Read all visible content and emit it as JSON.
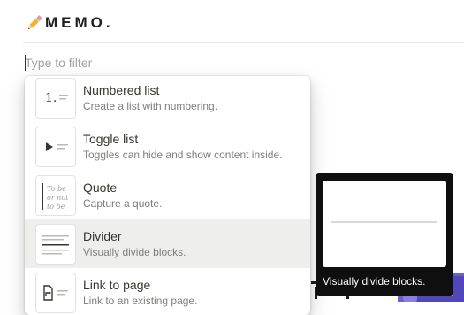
{
  "app": {
    "logo_icon": "pencil-icon",
    "title": "MEMO."
  },
  "filter": {
    "value": "",
    "placeholder": "Type to filter"
  },
  "menu": {
    "items": [
      {
        "label": "Numbered list",
        "description": "Create a list with numbering.",
        "icon": "numbered-list-thumbnail-icon",
        "highlighted": false
      },
      {
        "label": "Toggle list",
        "description": "Toggles can hide and show content inside.",
        "icon": "toggle-list-thumbnail-icon",
        "highlighted": false
      },
      {
        "label": "Quote",
        "description": "Capture a quote.",
        "icon": "quote-thumbnail-icon",
        "highlighted": false
      },
      {
        "label": "Divider",
        "description": "Visually divide blocks.",
        "icon": "divider-thumbnail-icon",
        "highlighted": true
      },
      {
        "label": "Link to page",
        "description": "Link to an existing page.",
        "icon": "link-to-page-thumbnail-icon",
        "highlighted": false
      }
    ],
    "thumbnail_quote_text": [
      "To be",
      "or not",
      "to be"
    ],
    "thumbnail_number_text": "1."
  },
  "preview": {
    "caption": "Visually divide blocks.",
    "icon": "divider-preview-icon"
  },
  "colors": {
    "highlight": "#eeeeec",
    "text": "#37352f",
    "muted": "#807e7a",
    "preview_bg": "#0f0f0f"
  }
}
